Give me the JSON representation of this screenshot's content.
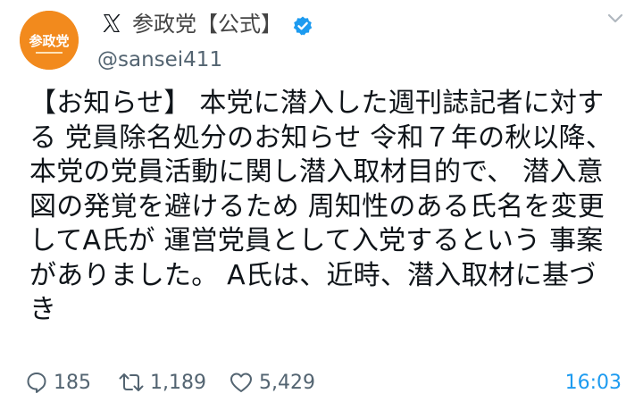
{
  "account": {
    "display_name": "参政党【公式】",
    "handle": "@sansei411",
    "avatar_text": "参政党"
  },
  "tweet": {
    "lines": [
      "【お知らせ】 本党に潜入した週刊誌記者に対す",
      "る 党員除名処分のお知らせ 令和７年の秋以降、",
      "本党の党員活動に関し潜入取材目的で、 潜入意",
      "図の発覚を避けるため 周知性のある氏名を変更",
      "してA氏が 運営党員として入党するという 事案",
      "がありました。 A氏は、近時、潜入取材に基づ",
      "き"
    ]
  },
  "stats": {
    "replies": "185",
    "retweets": "1,189",
    "likes": "5,429"
  },
  "time": "16:03",
  "icons": {
    "platform": "x-logo-icon",
    "verified": "verified-badge-icon",
    "menu": "chevron-down-icon",
    "reply": "reply-icon",
    "retweet": "retweet-icon",
    "like": "heart-icon"
  },
  "colors": {
    "avatar": "#f28a1d",
    "verified": "#1d9bf0",
    "link": "#1d9bf0",
    "muted": "#536471"
  }
}
